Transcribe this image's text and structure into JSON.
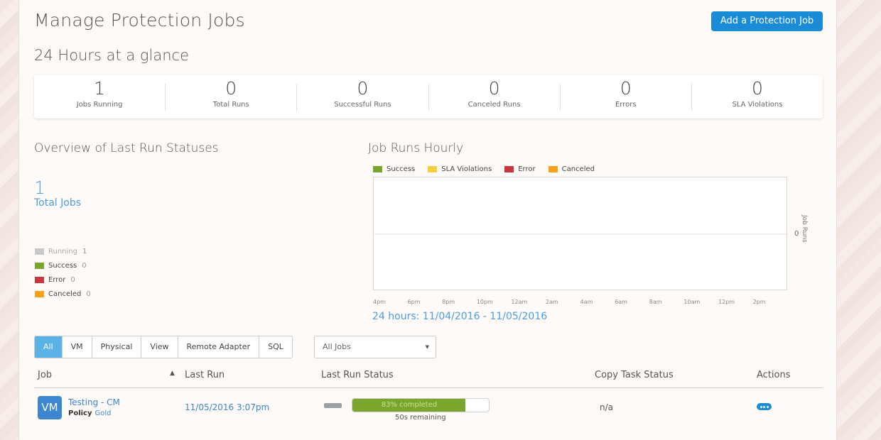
{
  "header": {
    "title": "Manage Protection Jobs",
    "add_button": "Add a Protection Job"
  },
  "glance": {
    "title": "24 Hours at a glance",
    "stats": [
      {
        "value": "1",
        "label": "Jobs Running"
      },
      {
        "value": "0",
        "label": "Total Runs"
      },
      {
        "value": "0",
        "label": "Successful Runs"
      },
      {
        "value": "0",
        "label": "Canceled Runs"
      },
      {
        "value": "0",
        "label": "Errors"
      },
      {
        "value": "0",
        "label": "SLA Violations"
      }
    ]
  },
  "overview": {
    "title": "Overview of Last Run Statuses",
    "total_value": "1",
    "total_label": "Total Jobs",
    "legend": [
      {
        "label": "Running",
        "count": "1",
        "color": "#c8c8c8"
      },
      {
        "label": "Success",
        "count": "0",
        "color": "#7ba62e"
      },
      {
        "label": "Error",
        "count": "0",
        "color": "#c9353e"
      },
      {
        "label": "Canceled",
        "count": "0",
        "color": "#f5a21a"
      }
    ]
  },
  "hourly": {
    "title": "Job Runs Hourly",
    "legend": [
      {
        "label": "Success",
        "color": "#7ba62e"
      },
      {
        "label": "SLA Violations",
        "color": "#f4d03f"
      },
      {
        "label": "Error",
        "color": "#c9353e"
      },
      {
        "label": "Canceled",
        "color": "#f5a21a"
      }
    ],
    "y_label": "Job Runs",
    "y_tick": "0",
    "x_ticks": [
      "4pm",
      "6pm",
      "8pm",
      "10pm",
      "12am",
      "2am",
      "4am",
      "6am",
      "8am",
      "10am",
      "12pm",
      "2pm"
    ],
    "range_label": "24 hours: 11/04/2016 - 11/05/2016"
  },
  "filters": {
    "tabs": [
      "All",
      "VM",
      "Physical",
      "View",
      "Remote Adapter",
      "SQL"
    ],
    "active": "All",
    "select_value": "All Jobs"
  },
  "table": {
    "headers": {
      "job": "Job",
      "last_run": "Last Run",
      "last_run_status": "Last Run Status",
      "copy_task_status": "Copy Task Status",
      "actions": "Actions"
    },
    "rows": [
      {
        "badge": "VM",
        "name": "Testing - CM",
        "policy_label": "Policy",
        "policy_value": "Gold",
        "last_run": "11/05/2016 3:07pm",
        "progress_percent": 83,
        "progress_text": "83% completed",
        "remaining": "50s remaining",
        "copy_status": "n/a"
      }
    ]
  }
}
